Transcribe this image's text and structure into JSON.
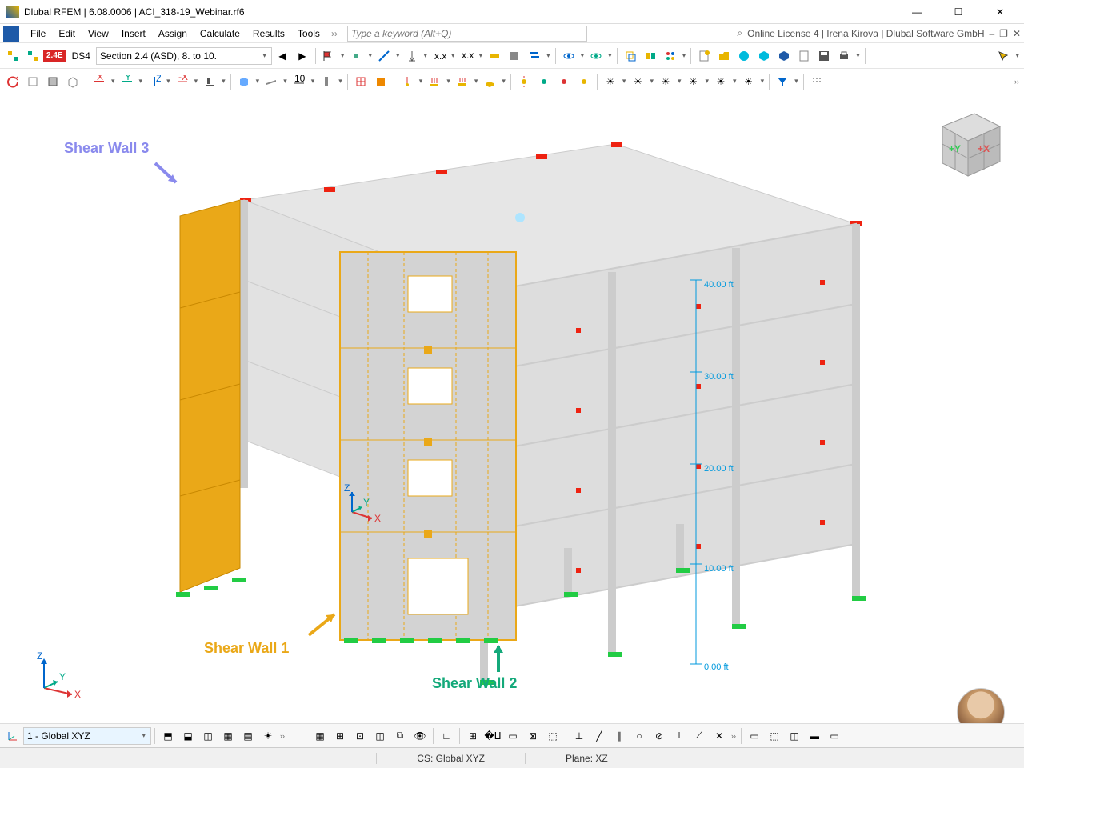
{
  "window": {
    "title": "Dlubal RFEM | 6.08.0006 | ACI_318-19_Webinar.rf6"
  },
  "menubar": {
    "items": [
      "File",
      "Edit",
      "View",
      "Insert",
      "Assign",
      "Calculate",
      "Results",
      "Tools"
    ],
    "search_placeholder": "Type a keyword (Alt+Q)",
    "license_info": "Online License 4 | Irena Kirova | Dlubal Software GmbH"
  },
  "toolbar1": {
    "badge": "2.4E",
    "lc_label": "DS4",
    "combo_value": "Section 2.4 (ASD), 8. to 10."
  },
  "annotations": {
    "wall1": "Shear Wall 1",
    "wall2": "Shear Wall 2",
    "wall3": "Shear Wall 3"
  },
  "dimensions": {
    "d0": "0.00 ft",
    "d1": "10.00 ft",
    "d2": "20.00 ft",
    "d3": "30.00 ft",
    "d4": "40.00 ft"
  },
  "axis": {
    "x": "X",
    "y": "Y",
    "z": "Z"
  },
  "bottom_combo": "1 - Global XYZ",
  "status": {
    "cs": "CS: Global XYZ",
    "plane": "Plane: XZ"
  },
  "gizmo": {
    "px": "+X",
    "py": "+Y"
  }
}
